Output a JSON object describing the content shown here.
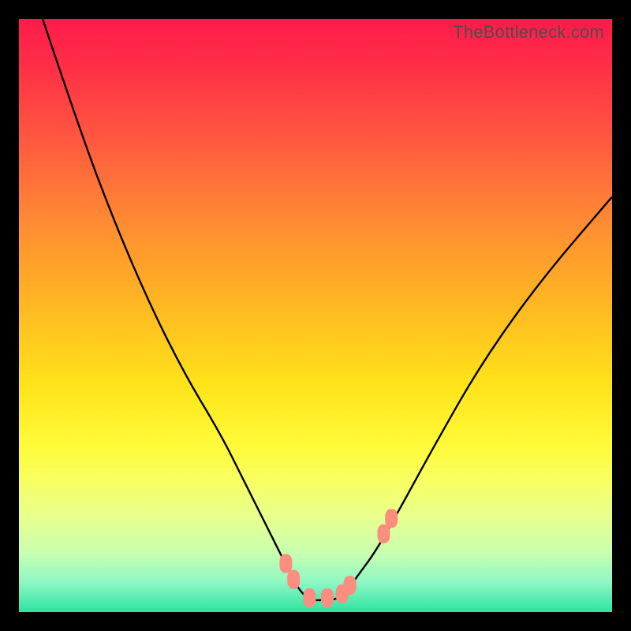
{
  "watermark": "TheBottleneck.com",
  "chart_data": {
    "type": "line",
    "title": "",
    "xlabel": "",
    "ylabel": "",
    "xlim": [
      0,
      100
    ],
    "ylim": [
      0,
      100
    ],
    "series": [
      {
        "name": "curve",
        "x": [
          4,
          10,
          16,
          22,
          28,
          34,
          38,
          42,
          45,
          47,
          49,
          51,
          53,
          55,
          57,
          60,
          64,
          70,
          78,
          88,
          100
        ],
        "y": [
          100,
          82,
          66,
          52,
          40,
          30,
          22,
          14,
          8,
          4,
          2,
          2,
          2,
          3,
          6,
          10,
          17,
          28,
          42,
          56,
          70
        ]
      },
      {
        "name": "markers",
        "x": [
          45,
          46.3,
          49,
          52,
          54.5,
          55.8,
          61.5,
          62.8
        ],
        "y": [
          8.2,
          5.5,
          2.4,
          2.4,
          3.1,
          4.5,
          13.2,
          15.8
        ]
      }
    ],
    "marker_color": "#fb8e7f",
    "line_color": "#000000",
    "gradient_stops": [
      {
        "pos": 0,
        "color": "#ff1a4b"
      },
      {
        "pos": 8,
        "color": "#ff2f46"
      },
      {
        "pos": 20,
        "color": "#ff5740"
      },
      {
        "pos": 34,
        "color": "#ff8a33"
      },
      {
        "pos": 48,
        "color": "#ffb722"
      },
      {
        "pos": 62,
        "color": "#ffe41a"
      },
      {
        "pos": 72,
        "color": "#fffb3a"
      },
      {
        "pos": 78,
        "color": "#f7ff62"
      },
      {
        "pos": 84,
        "color": "#e7ff8e"
      },
      {
        "pos": 90,
        "color": "#c9ffb0"
      },
      {
        "pos": 95,
        "color": "#8ef7c4"
      },
      {
        "pos": 100,
        "color": "#2de3a1"
      }
    ]
  }
}
